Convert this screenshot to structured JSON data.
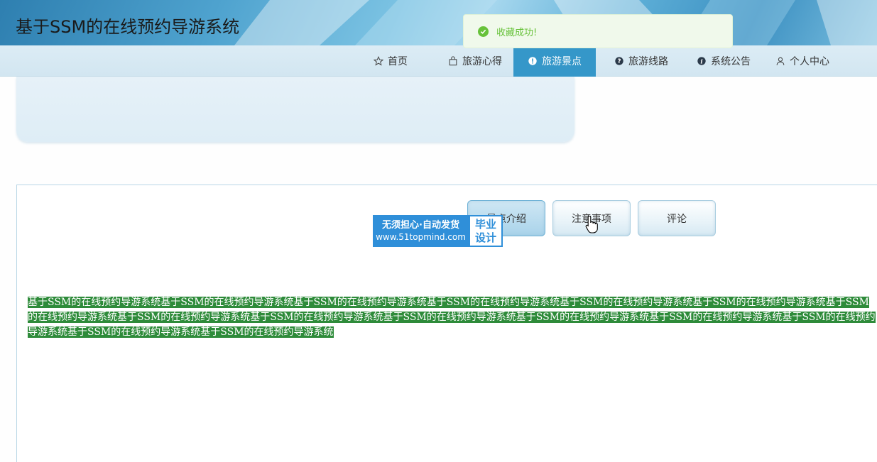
{
  "header": {
    "site_title": "基于SSM的在线预约导游系统"
  },
  "toast": {
    "message": "收藏成功!",
    "status_color": "#67c23a"
  },
  "nav": {
    "items": [
      {
        "label": "首页",
        "icon": "star-icon",
        "active": false
      },
      {
        "label": "旅游心得",
        "icon": "bag-icon",
        "active": false
      },
      {
        "label": "旅游景点",
        "icon": "exclamation-circle-icon",
        "active": true
      },
      {
        "label": "旅游线路",
        "icon": "question-circle-icon",
        "active": false
      },
      {
        "label": "系统公告",
        "icon": "info-circle-icon",
        "active": false
      },
      {
        "label": "个人中心",
        "icon": "user-icon",
        "active": false
      }
    ],
    "active_color": "#3597c9"
  },
  "tabs": [
    {
      "label": "景点介绍",
      "active": true
    },
    {
      "label": "注意事项",
      "active": false
    },
    {
      "label": "评论",
      "active": false
    }
  ],
  "watermark": {
    "line1": "无须担心·自动发货",
    "line2": "www.51topmind.com",
    "side1": "毕业",
    "side2": "设计"
  },
  "content": {
    "intro_text": "基于SSM的在线预约导游系统基于SSM的在线预约导游系统基于SSM的在线预约导游系统基于SSM的在线预约导游系统基于SSM的在线预约导游系统基于SSM的在线预约导游系统基于SSM的在线预约导游系统基于SSM的在线预约导游系统基于SSM的在线预约导游系统基于SSM的在线预约导游系统基于SSM的在线预约导游系统基于SSM的在线预约导游系统基于SSM的在线预约导游系统基于SSM的在线预约导游系统基于SSM的在线预约导游系统",
    "highlight_color": "#2e8b3a"
  }
}
